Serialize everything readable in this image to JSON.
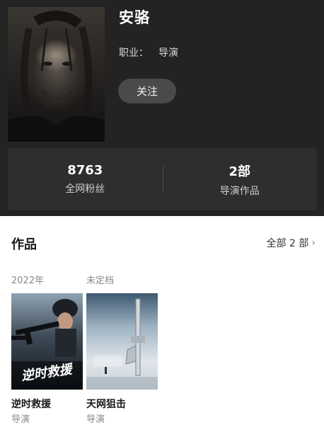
{
  "profile": {
    "name": "安骆",
    "job_label": "职业：",
    "job_value": "导演",
    "follow_label": "关注"
  },
  "stats": [
    {
      "value": "8763",
      "label": "全网粉丝"
    },
    {
      "value": "2部",
      "label": "导演作品"
    }
  ],
  "works": {
    "title": "作品",
    "all_label": "全部 2 部",
    "items": [
      {
        "year": "2022年",
        "title": "逆时救援",
        "role": "导演",
        "poster_text": "逆时救援"
      },
      {
        "year": "未定档",
        "title": "天网狙击",
        "role": "导演"
      }
    ]
  },
  "icons": {
    "more": "chevron-right-icon"
  },
  "colors": {
    "header_bg": "#232324",
    "stats_bg": "#2e2e30",
    "follow_bg": "#4a4a4c"
  }
}
